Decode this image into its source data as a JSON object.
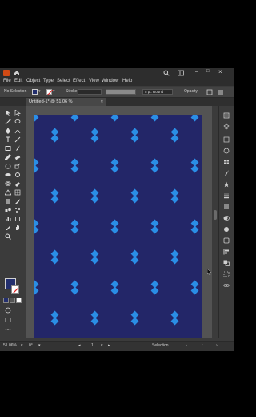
{
  "menu": [
    "File",
    "Edit",
    "Object",
    "Type",
    "Select",
    "Effect",
    "View",
    "Window",
    "Help"
  ],
  "control": {
    "selection_label": "No Selection",
    "stroke_label": "Stroke:",
    "brush_value": "5 pt. Round",
    "opacity_label": "Opacity:"
  },
  "document": {
    "tab_title": "Untitled-1* @ 51.06 % (CMYK/Preview)",
    "close_glyph": "×"
  },
  "status": {
    "zoom": "51.06%",
    "rotation": "0°",
    "artboard": "1",
    "mode": "Selection"
  },
  "colors": {
    "artboard_bg": "#232668",
    "pattern_diamond": "#2a8ee6",
    "fill_swatch": "#232f6e",
    "app_brand": "#d14a15"
  },
  "icons": [
    "home-icon",
    "search-icon",
    "workspace-icon",
    "selection-tool-icon",
    "direct-selection-tool-icon",
    "pen-tool-icon",
    "type-tool-icon",
    "rectangle-tool-icon",
    "brush-tool-icon",
    "rotate-tool-icon",
    "scale-tool-icon",
    "eyedropper-tool-icon",
    "zoom-tool-icon",
    "hand-tool-icon",
    "properties-panel-icon",
    "layers-panel-icon",
    "libraries-panel-icon",
    "color-panel-icon",
    "swatches-panel-icon"
  ]
}
